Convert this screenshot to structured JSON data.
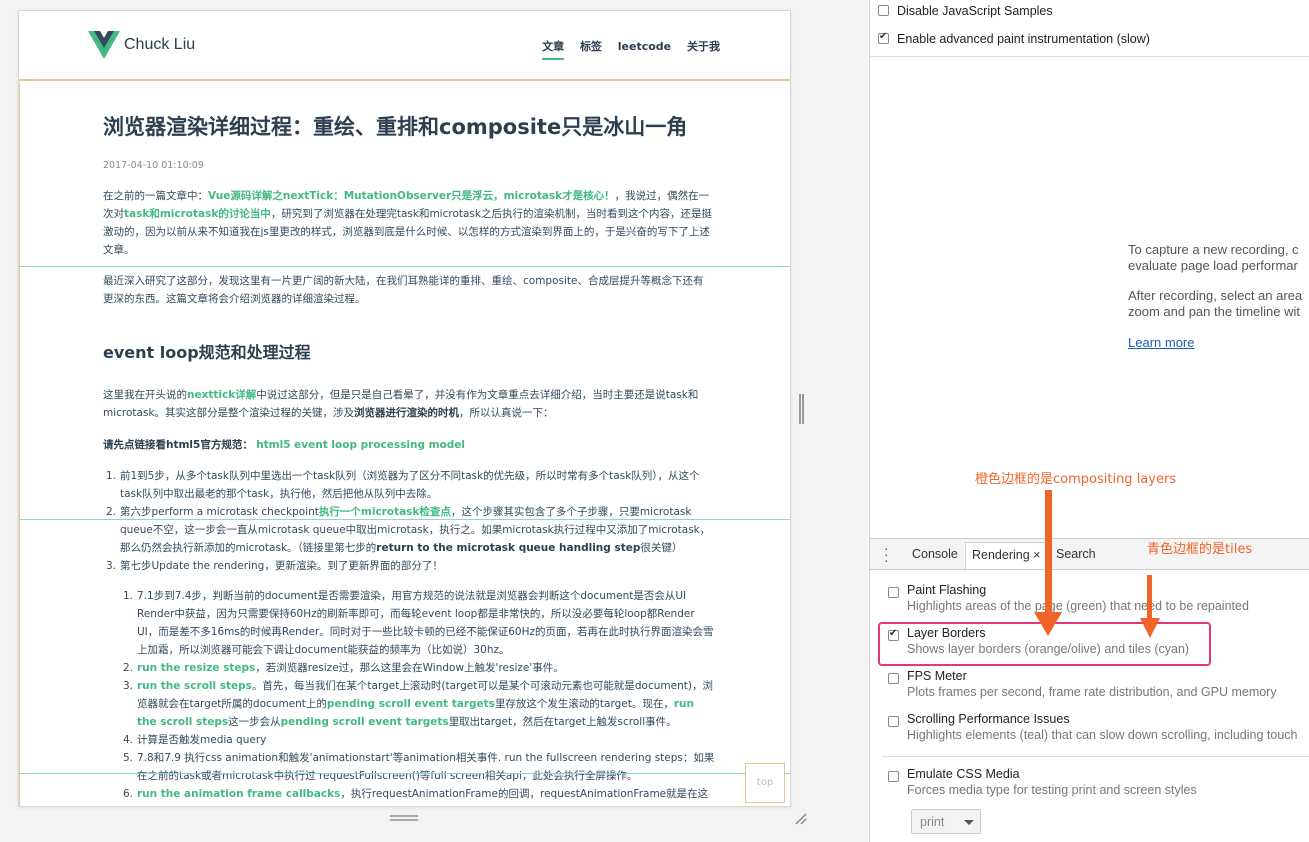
{
  "site": {
    "logo_text": "Chuck Liu",
    "nav": [
      "文章",
      "标签",
      "leetcode",
      "关于我"
    ]
  },
  "article": {
    "title": "浏览器渲染详细过程：重绘、重排和composite只是冰山一角",
    "date": "2017-04-10 01:10:09",
    "p1": {
      "a": "在之前的一篇文章中：",
      "link1": "Vue源码详解之nextTick：MutationObserver只是浮云，microtask才是核心！",
      "b": "，我说过，偶然在一次对",
      "link2": "task和microtask的讨论当中",
      "c": "，研究到了浏览器在处理完task和microtask之后执行的渲染机制，当时看到这个内容，还是挺激动的，因为以前从来不知道我在js里更改的样式，浏览器到底是什么时候、以怎样的方式渲染到界面上的，于是兴奋的写下了上述文章。"
    },
    "p2": "最近深入研究了这部分，发现这里有一片更广阔的新大陆，在我们耳熟能详的重排、重绘、composite、合成层提升等概念下还有更深的东西。这篇文章将会介绍浏览器的详细渲染过程。",
    "h2": "event loop规范和处理过程",
    "p3": {
      "a": "这里我在开头说的",
      "link": "nexttick详解",
      "b": "中说过这部分，但是只是自己看晕了，并没有作为文章重点去详细介绍，当时主要还是说task和microtask。其实这部分是整个渲染过程的关键，涉及",
      "strong": "浏览器进行渲染的时机",
      "c": "，所以认真说一下："
    },
    "p4": {
      "strong": "请先点链接看html5官方规范：",
      "link": "html5 event loop processing model"
    },
    "list1": [
      {
        "num": "1.",
        "text": "前1到5步，从多个task队列中里选出一个task队列（浏览器为了区分不同task的优先级，所以时常有多个task队列），从这个task队列中取出最老的那个task，执行他，然后把他从队列中去除。"
      },
      {
        "num": "2.",
        "a": "第六步perform a microtask checkpoint",
        "link": "执行一个microtask检查点",
        "b": "，这个步骤其实包含了多个子步骤，只要microtask queue不空，这一步会一直从microtask queue中取出microtask，执行之。如果microtask执行过程中又添加了microtask，那么仍然会执行新添加的microtask。（链接里第七步的",
        "strong": "return to the microtask queue handling step",
        "c": "很关键）"
      },
      {
        "num": "3.",
        "text": "第七步Update the rendering，更新渲染。到了更新界面的部分了！"
      }
    ],
    "list2": [
      {
        "num": "1.",
        "text": "7.1步到7.4步，判断当前的document是否需要渲染，用官方规范的说法就是浏览器会判断这个document是否会从UI Render中获益，因为只需要保持60Hz的刷新率即可，而每轮event loop都是非常快的，所以没必要每轮loop都Render UI，而是差不多16ms的时候再Render。同时对于一些比较卡顿的已经不能保证60Hz的页面，若再在此时执行界面渲染会雪上加霜，所以浏览器可能会下调让document能获益的频率为（比如说）30hz。"
      },
      {
        "num": "2.",
        "link": "run the resize steps",
        "text": "，若浏览器resize过，那么这里会在Window上触发'resize'事件。"
      },
      {
        "num": "3.",
        "link": "run the scroll steps",
        "a": "。首先，每当我们在某个target上滚动时(target可以是某个可滚动元素也可能就是document)，浏览器就会在target所属的document上的",
        "link2": "pending scroll event targets",
        "b": "里存放这个发生滚动的target。现在，",
        "link3": "run the scroll steps",
        "c": "这一步会从",
        "link4": "pending scroll event targets",
        "d": "里取出target，然后在target上触发scroll事件。"
      },
      {
        "num": "4.",
        "text": "计算是否触发media query"
      },
      {
        "num": "5.",
        "text": "7.8和7.9 执行css animation和触发'animationstart'等animation相关事件. run the fullscreen rendering steps：如果在之前的task或者microtask中执行过 requestFullscreen()等full screen相关api，此处会执行全屏操作。"
      },
      {
        "num": "6.",
        "link": "run the animation frame callbacks",
        "text": "，执行requestAnimationFrame的回调，requestAnimationFrame就是在这里执行"
      }
    ],
    "top_button": "top"
  },
  "devtools": {
    "top_options": [
      {
        "label": "Disable JavaScript Samples",
        "checked": false
      },
      {
        "label": "Enable advanced paint instrumentation (slow)",
        "checked": true
      }
    ],
    "info_lines": [
      "To capture a new recording, c",
      "evaluate page load performar",
      "After recording, select an area",
      "zoom and pan the timeline wit"
    ],
    "learn_more": "Learn more",
    "drawer_tabs": [
      "Console",
      "Rendering",
      "Search"
    ],
    "close_glyph": "×",
    "rendering_options": [
      {
        "title": "Paint Flashing",
        "desc": "Highlights areas of the page (green) that need to be repainted",
        "checked": false
      },
      {
        "title": "Layer Borders",
        "desc": "Shows layer borders (orange/olive) and tiles (cyan)",
        "checked": true
      },
      {
        "title": "FPS Meter",
        "desc": "Plots frames per second, frame rate distribution, and GPU memory",
        "checked": false
      },
      {
        "title": "Scrolling Performance Issues",
        "desc": "Highlights elements (teal) that can slow down scrolling, including touch",
        "checked": false
      },
      {
        "title": "Emulate CSS Media",
        "desc": "Forces media type for testing print and screen styles",
        "checked": false
      }
    ],
    "media_select": "print"
  },
  "annotations": {
    "orange_label": "橙色边框的是compositing layers",
    "cyan_label": "青色边框的是tiles",
    "color": "#f0642a",
    "box_color": "#e8357a"
  },
  "colors": {
    "accent_green": "#42b983",
    "layer_border": "#e8c98a",
    "tile_border": "#8fd3db"
  }
}
